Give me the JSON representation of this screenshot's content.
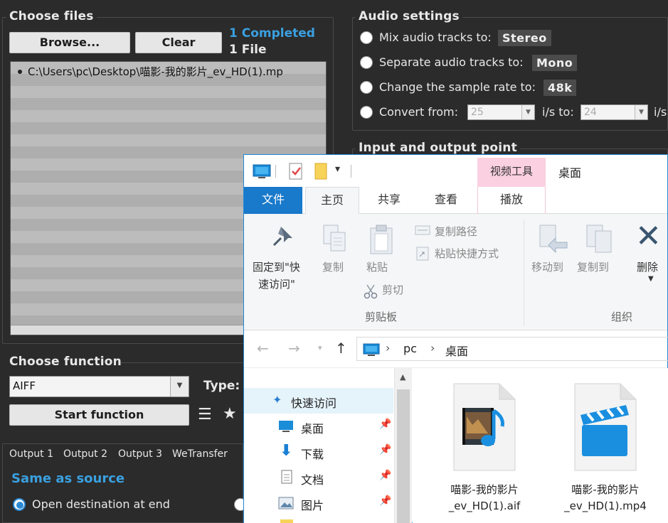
{
  "app": {
    "choose_files": {
      "title": "Choose files",
      "browse_label": "Browse...",
      "clear_label": "Clear",
      "completed_text": "1 Completed",
      "file_count_text": "1 File",
      "files": [
        "C:\\Users\\pc\\Desktop\\喵影-我的影片_ev_HD(1).mp"
      ]
    },
    "audio_settings": {
      "title": "Audio settings",
      "mix_label": "Mix audio tracks to:",
      "mix_value": "Stereo",
      "separate_label": "Separate audio tracks to:",
      "separate_value": "Mono",
      "sample_label": "Change the sample rate to:",
      "sample_value": "48k",
      "convert_label": "Convert from:",
      "convert_from_value": "25",
      "fps_unit_1": "i/s to:",
      "convert_to_value": "24",
      "fps_unit_2": "i/s"
    },
    "io_point": {
      "title": "Input and output point"
    },
    "choose_function": {
      "title": "Choose function",
      "format_value": "AIFF",
      "type_label": "Type:",
      "start_label": "Start function"
    },
    "output_tabs": [
      "Output 1",
      "Output 2",
      "Output 3",
      "WeTransfer"
    ],
    "output": {
      "destination_text": "Same as source",
      "open_dest_label": "Open destination at end"
    }
  },
  "explorer": {
    "context_tab": "视频工具",
    "window_title": "桌面",
    "ribbon_tabs": {
      "file": "文件",
      "home": "主页",
      "share": "共享",
      "view": "查看",
      "play": "播放"
    },
    "ribbon": {
      "pin_label_1": "固定到\"快",
      "pin_label_2": "速访问\"",
      "copy_label": "复制",
      "paste_label": "粘贴",
      "copy_path_label": "复制路径",
      "paste_shortcut_label": "粘贴快捷方式",
      "cut_label": "剪切",
      "clipboard_group": "剪贴板",
      "move_to_label": "移动到",
      "copy_to_label": "复制到",
      "delete_label": "删除",
      "organize_group": "组织"
    },
    "address": {
      "root": "pc",
      "folder": "桌面"
    },
    "nav": {
      "quick_access": "快速访问",
      "items": [
        "桌面",
        "下载",
        "文档",
        "图片"
      ]
    },
    "files": [
      {
        "name_line1": "喵影-我的影片",
        "name_line2": "_ev_HD(1).aif"
      },
      {
        "name_line1": "喵影-我的影片",
        "name_line2": "_ev_HD(1).mp4"
      }
    ],
    "colors": {
      "accent": "#1979ca",
      "context_tab": "#fbd0e0",
      "selection": "#e5f3fb"
    }
  }
}
